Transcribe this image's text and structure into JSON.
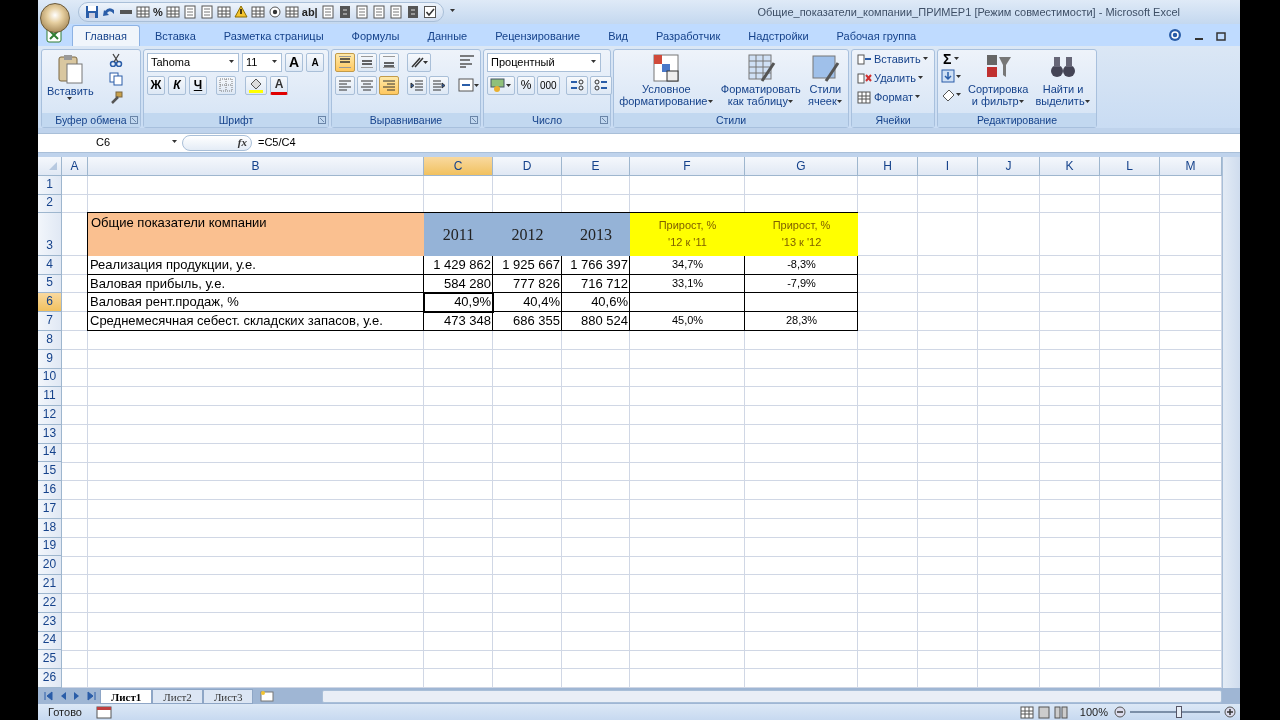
{
  "window": {
    "title": "Общие_показатели_компании_ПРИМЕР1  [Режим совместимости] - Microsoft Excel"
  },
  "quick_access": [
    "%",
    "ab|"
  ],
  "tabs": [
    {
      "label": "Главная",
      "selected": true
    },
    {
      "label": "Вставка",
      "selected": false
    },
    {
      "label": "Разметка страницы",
      "selected": false
    },
    {
      "label": "Формулы",
      "selected": false
    },
    {
      "label": "Данные",
      "selected": false
    },
    {
      "label": "Рецензирование",
      "selected": false
    },
    {
      "label": "Вид",
      "selected": false
    },
    {
      "label": "Разработчик",
      "selected": false
    },
    {
      "label": "Надстройки",
      "selected": false
    },
    {
      "label": "Рабочая группа",
      "selected": false
    }
  ],
  "ribbon": {
    "clipboard": {
      "label": "Буфер обмена",
      "paste": "Вставить"
    },
    "font": {
      "label": "Шрифт",
      "font_name": "Tahoma",
      "font_size": "11",
      "grow": "A",
      "shrink": "A",
      "bold": "Ж",
      "italic": "К",
      "underline": "Ч",
      "font_color": "A"
    },
    "alignment": {
      "label": "Выравнивание",
      "top_active": true,
      "middle_active": false,
      "bottom_active": false,
      "left_active": false,
      "center_active": false,
      "right_active": true
    },
    "number": {
      "label": "Число",
      "format": "Процентный",
      "percent": "%",
      "thousands": "000"
    },
    "styles": {
      "label": "Стили",
      "buttons": [
        {
          "lines": [
            "Условное",
            "форматирование"
          ]
        },
        {
          "lines": [
            "Форматировать",
            "как таблицу"
          ]
        },
        {
          "lines": [
            "Стили",
            "ячеек"
          ]
        }
      ]
    },
    "cells": {
      "label": "Ячейки",
      "buttons": [
        "Вставить",
        "Удалить",
        "Формат"
      ]
    },
    "editing": {
      "label": "Редактирование",
      "sum": "Σ",
      "buttons": [
        {
          "lines": [
            "Сортировка",
            "и фильтр"
          ]
        },
        {
          "lines": [
            "Найти и",
            "выделить"
          ]
        }
      ]
    }
  },
  "formula_bar": {
    "name_box": "C6",
    "fx": "fx",
    "formula": "=C5/C4"
  },
  "columns": [
    {
      "label": "A",
      "selected": false
    },
    {
      "label": "B",
      "selected": false
    },
    {
      "label": "C",
      "selected": true
    },
    {
      "label": "D",
      "selected": false
    },
    {
      "label": "E",
      "selected": false
    },
    {
      "label": "F",
      "selected": false
    },
    {
      "label": "G",
      "selected": false
    },
    {
      "label": "H",
      "selected": false
    },
    {
      "label": "I",
      "selected": false
    },
    {
      "label": "J",
      "selected": false
    },
    {
      "label": "K",
      "selected": false
    },
    {
      "label": "L",
      "selected": false
    },
    {
      "label": "M",
      "selected": false
    }
  ],
  "rows": [
    {
      "number": "1",
      "selected": false
    },
    {
      "number": "2",
      "selected": false
    },
    {
      "number": "3",
      "selected": false,
      "cells": [
        {
          "text": "Общие показатели компании",
          "kind": "title"
        },
        {
          "text": "2011",
          "kind": "year"
        },
        {
          "text": "2012",
          "kind": "year"
        },
        {
          "text": "2013",
          "kind": "year"
        },
        {
          "lines": [
            "Прирост, %",
            "'12 к '11"
          ],
          "kind": "growth"
        },
        {
          "lines": [
            "Прирост, %",
            "'13 к '12"
          ],
          "kind": "growth"
        }
      ]
    },
    {
      "number": "4",
      "selected": false,
      "cells": [
        "Реализация продукции, у.е.",
        "1 429 862",
        "1 925 667",
        "1 766 397",
        "34,7%",
        "-8,3%"
      ]
    },
    {
      "number": "5",
      "selected": false,
      "cells": [
        "Валовая прибыль, у.е.",
        "584 280",
        "777 826",
        "716 712",
        "33,1%",
        "-7,9%"
      ]
    },
    {
      "number": "6",
      "selected": true,
      "cells": [
        "Валовая рент.продаж, %",
        "40,9%",
        "40,4%",
        "40,6%"
      ]
    },
    {
      "number": "7",
      "selected": false,
      "cells": [
        "Среднемесячная себест. складских запасов, у.е.",
        "473 348",
        "686 355",
        "880 524",
        "45,0%",
        "28,3%"
      ]
    },
    {
      "number": "8",
      "selected": false
    },
    {
      "number": "9",
      "selected": false
    },
    {
      "number": "10",
      "selected": false
    },
    {
      "number": "11",
      "selected": false
    },
    {
      "number": "12",
      "selected": false
    },
    {
      "number": "13",
      "selected": false
    },
    {
      "number": "14",
      "selected": false
    },
    {
      "number": "15",
      "selected": false
    },
    {
      "number": "16",
      "selected": false
    },
    {
      "number": "17",
      "selected": false
    },
    {
      "number": "18",
      "selected": false
    },
    {
      "number": "19",
      "selected": false
    },
    {
      "number": "20",
      "selected": false
    },
    {
      "number": "21",
      "selected": false
    },
    {
      "number": "22",
      "selected": false
    },
    {
      "number": "23",
      "selected": false
    },
    {
      "number": "24",
      "selected": false
    },
    {
      "number": "25",
      "selected": false
    },
    {
      "number": "26",
      "selected": false
    }
  ],
  "sheet_tabs": [
    {
      "label": "Лист1",
      "selected": true
    },
    {
      "label": "Лист2",
      "selected": false
    },
    {
      "label": "Лист3",
      "selected": false
    }
  ],
  "status_bar": {
    "text": "Готово",
    "zoom": "100%",
    "zoom_slider": {
      "level": 0.55
    }
  }
}
